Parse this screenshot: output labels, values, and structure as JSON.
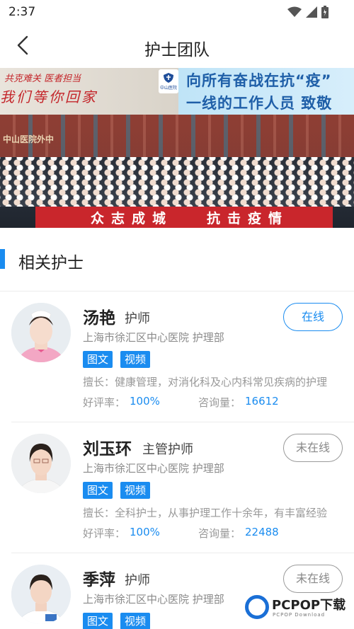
{
  "status_bar": {
    "time": "2:37",
    "icons": [
      "wifi-icon",
      "signal-icon",
      "battery-icon"
    ]
  },
  "nav": {
    "title": "护士团队",
    "back_icon": "chevron-left-icon"
  },
  "banner": {
    "slogan_line1": "共克难关 医者担当",
    "slogan_line2": "我们等你回家",
    "logo_text": "中山医院",
    "headline_line1": "向所有奋战在抗“疫”",
    "headline_line2": "一线的工作人员 致敬",
    "hospital_sign": "中山医院外中",
    "strip_text_1": "众志成城",
    "strip_text_2": "抗击疫情"
  },
  "section": {
    "title": "相关护士"
  },
  "labels": {
    "tag_text": "图文",
    "tag_video": "视频",
    "rating_label": "好评率：",
    "consult_label": "咨询量："
  },
  "nurses": [
    {
      "name": "汤艳",
      "title": "护师",
      "hospital": "上海市徐汇区中心医院  护理部",
      "speciality": "擅长：健康管理，对消化科及心内科常见疾病的护理",
      "rating": "100%",
      "consults": "16612",
      "status": "在线"
    },
    {
      "name": "刘玉环",
      "title": "主管护师",
      "hospital": "上海市徐汇区中心医院  护理部",
      "speciality": "擅长：全科护士，从事护理工作十余年，有丰富经验",
      "rating": "100%",
      "consults": "22488",
      "status": "未在线"
    },
    {
      "name": "季萍",
      "title": "护师",
      "hospital": "上海市徐汇区中心医院  护理部",
      "speciality": "",
      "rating": "",
      "consults": "",
      "status": "未在线"
    }
  ],
  "watermark": {
    "brand": "PCPOP下载",
    "sub": "PCPOP Download"
  },
  "colors": {
    "accent": "#1a8cf0",
    "banner_red": "#c9262c",
    "text_gray": "#999999"
  }
}
